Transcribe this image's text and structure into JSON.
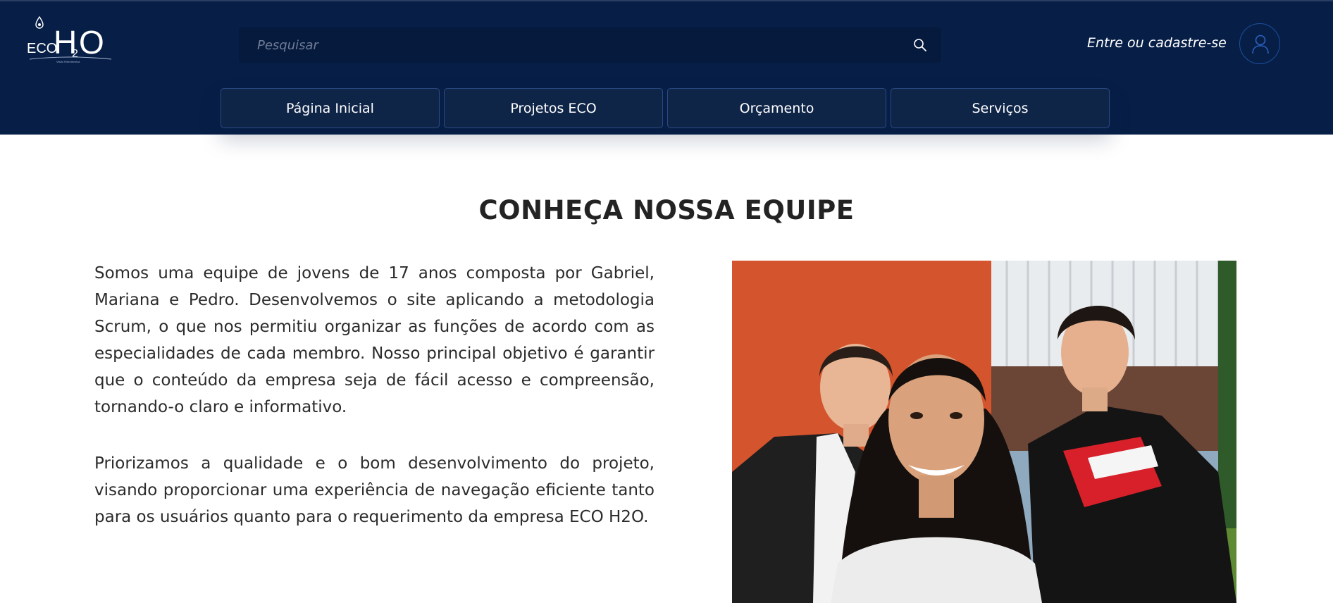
{
  "brand": {
    "logo_eco": "ECO",
    "logo_h": "H",
    "logo_sub": "2",
    "logo_o": "O",
    "logo_tagline": "Visão Hidrotécnica"
  },
  "search": {
    "placeholder": "Pesquisar",
    "icon": "search-icon"
  },
  "account": {
    "login_label": "Entre ou cadastre-se",
    "icon": "user-icon"
  },
  "nav": {
    "items": [
      {
        "label": "Página Inicial"
      },
      {
        "label": "Projetos ECO"
      },
      {
        "label": "Orçamento"
      },
      {
        "label": "Serviços"
      }
    ]
  },
  "main": {
    "title": "CONHEÇA NOSSA EQUIPE",
    "paragraphs": [
      "Somos uma equipe de jovens de 17 anos composta por Gabriel, Mariana e Pedro. Desenvolvemos o site aplicando a metodologia Scrum, o que nos permitiu organizar as funções de acordo com as especialidades de cada membro. Nosso principal objetivo é garantir que o conteúdo da empresa seja de fácil acesso e compreensão, tornando-o claro e informativo.",
      "Priorizamos a qualidade e o bom desenvolvimento do projeto, visando proporcionar uma experiência de navegação eficiente tanto para os usuários quanto para o requerimento da empresa ECO H2O."
    ]
  },
  "colors": {
    "header_bg": "#071f47",
    "nav_button_bg": "#0f2548",
    "accent_border": "#2a4a82",
    "text": "#2b2b2b"
  }
}
